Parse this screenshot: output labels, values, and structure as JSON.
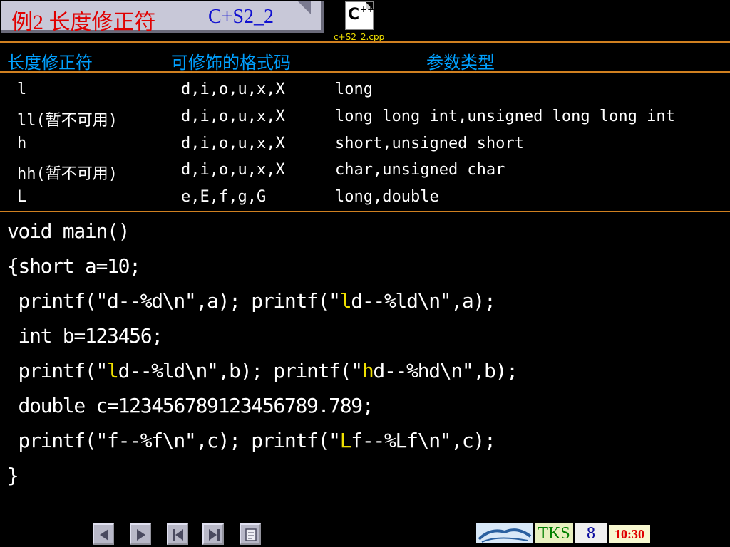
{
  "title": {
    "main": "例2 长度修正符",
    "code": "C+S2_2"
  },
  "file": {
    "icon": "cpp-file-icon",
    "name": "c+S2_2.cpp"
  },
  "table": {
    "headers": [
      "长度修正符",
      "可修饰的格式码",
      "参数类型"
    ],
    "rows": [
      [
        "l",
        "d,i,o,u,x,X",
        "long"
      ],
      [
        "ll(暂不可用)",
        "d,i,o,u,x,X",
        "long long int,unsigned long long int"
      ],
      [
        "h",
        "d,i,o,u,x,X",
        "short,unsigned short"
      ],
      [
        "hh(暂不可用)",
        "d,i,o,u,x,X",
        "char,unsigned char"
      ],
      [
        "L",
        "e,E,f,g,G",
        "long,double"
      ]
    ]
  },
  "code": {
    "line1": "void main()",
    "line2": "{short a=10;",
    "line3a": " printf(\"d--%d\\n\",a); printf(\"",
    "line3h": "l",
    "line3b": "d--%ld\\n\",a);",
    "line4": " int b=123456;",
    "line5a": " printf(\"",
    "line5h1": "l",
    "line5b": "d--%ld\\n\",b); printf(\"",
    "line5h2": "h",
    "line5c": "d--%hd\\n\",b);",
    "line6": " double c=123456789123456789.789;",
    "line7a": " printf(\"f--%f\\n\",c); printf(\"",
    "line7h": "L",
    "line7b": "f--%Lf\\n\",c);",
    "line8": "}"
  },
  "footer": {
    "nav_icons": [
      "previous-icon",
      "next-icon",
      "first-icon",
      "last-icon",
      "page-icon"
    ],
    "brand": "TKS",
    "page_number": "8",
    "time": "10:30"
  },
  "colors": {
    "background": "#000000",
    "title_red": "#e00000",
    "header_blue": "#00a0ff",
    "highlight_yellow": "#f0e000",
    "divider_orange": "#d08020"
  }
}
